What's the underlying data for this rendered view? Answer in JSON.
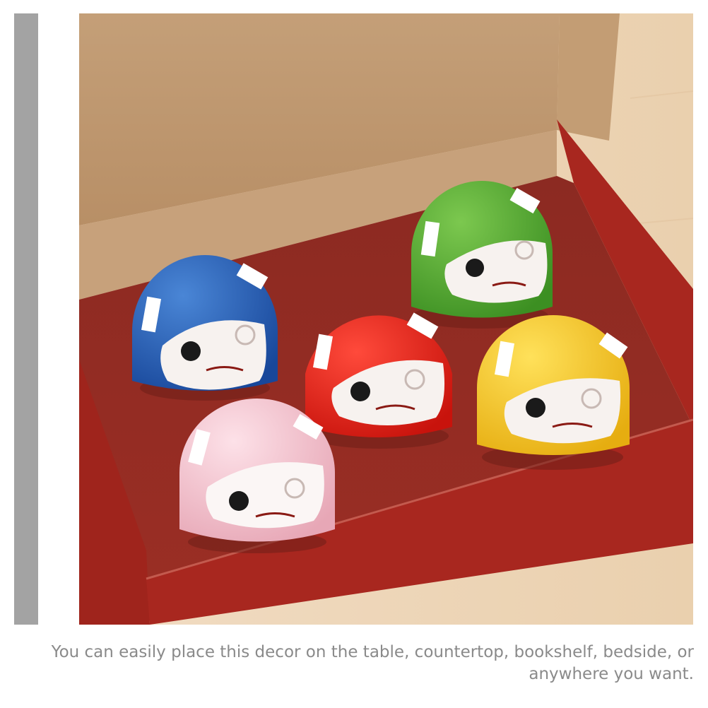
{
  "caption": {
    "text": "You can easily place this decor on the table, countertop, bookshelf, bedside, or anywhere you want."
  },
  "photo": {
    "subject": "daruma-figurines-in-box",
    "colors": {
      "sidebar": "#a3a3a3",
      "caption_text": "#8a8a8a",
      "box_red": "#a8271f",
      "felt_red": "#8f2a22",
      "cardboard": "#c8a27a",
      "daruma_blue": "#1f58b0",
      "daruma_green": "#4da52c",
      "daruma_red": "#e01a12",
      "daruma_yellow": "#f1c21b",
      "daruma_pink": "#f3bfcb"
    }
  }
}
